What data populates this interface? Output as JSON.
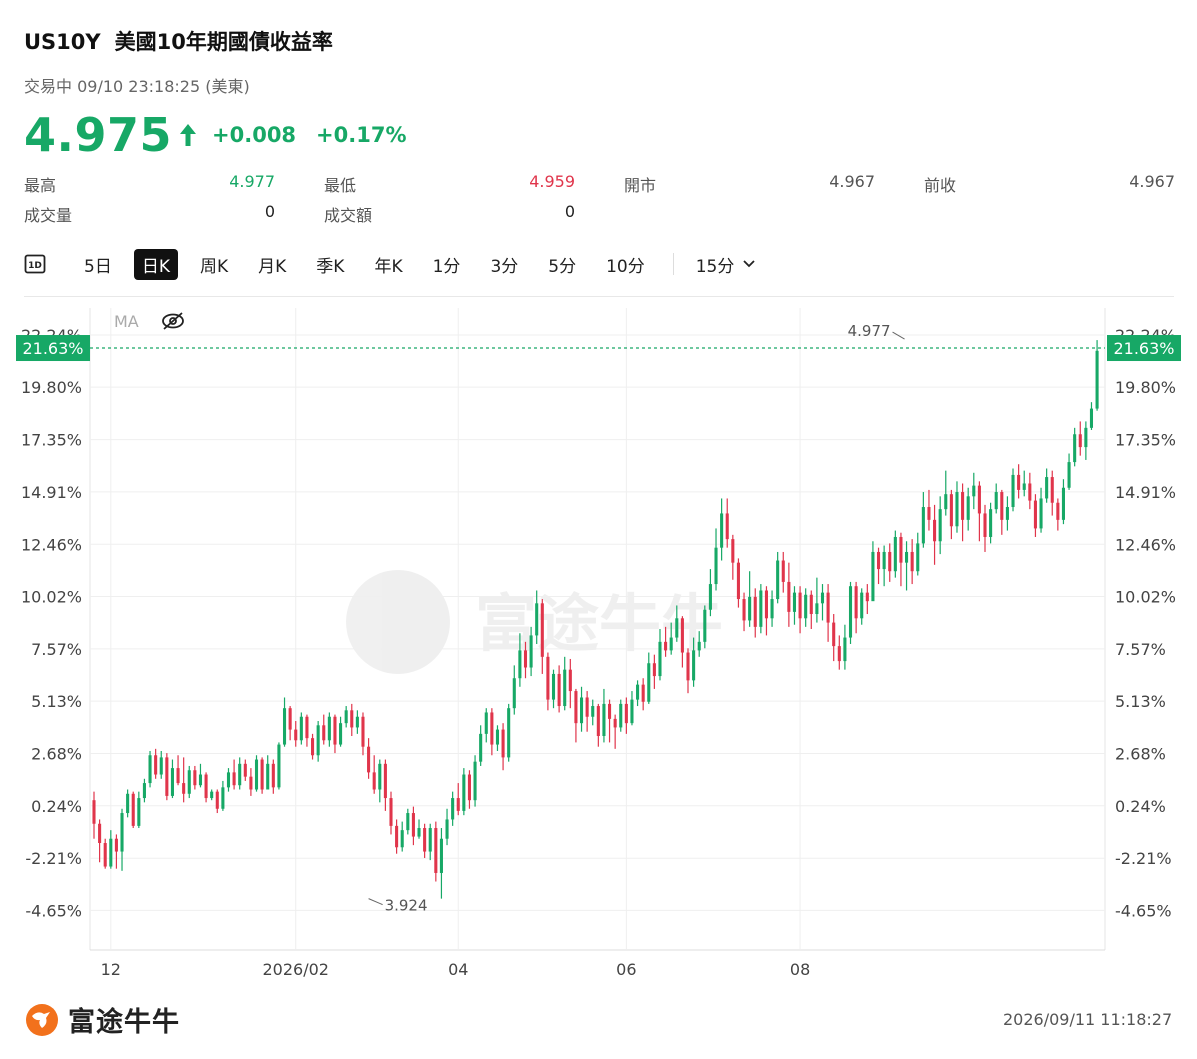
{
  "header": {
    "symbol": "US10Y",
    "name": "美國10年期國債收益率",
    "status": "交易中 09/10 23:18:25 (美東)",
    "price": "4.975",
    "change": "+0.008",
    "change_pct": "+0.17%"
  },
  "stats": [
    {
      "label": "最高",
      "value": "4.977",
      "color": "#17a866"
    },
    {
      "label": "最低",
      "value": "4.959",
      "color": "#e0354b"
    },
    {
      "label": "開市",
      "value": "4.967",
      "color": "#555555"
    },
    {
      "label": "前收",
      "value": "4.967",
      "color": "#555555"
    },
    {
      "label": "成交量",
      "value": "0",
      "color": "#222222"
    },
    {
      "label": "成交額",
      "value": "0",
      "color": "#222222"
    }
  ],
  "tabs": [
    "5日",
    "日K",
    "周K",
    "月K",
    "季K",
    "年K",
    "1分",
    "3分",
    "5分",
    "10分",
    "15分"
  ],
  "active_tab": "日K",
  "tab_icon_label": "1D",
  "indicator": {
    "label": "MA"
  },
  "footer": {
    "brand": "富途牛牛",
    "timestamp": "2026/09/11 11:18:27"
  },
  "colors": {
    "up": "#17a866",
    "down": "#e0354b",
    "grid": "#efefef",
    "axis_text": "#444444"
  },
  "chart_data": {
    "type": "candlestick",
    "y_unit": "percent change",
    "yticks": [
      22.24,
      19.8,
      17.35,
      14.91,
      12.46,
      10.02,
      7.57,
      5.13,
      2.68,
      0.24,
      -2.21,
      -4.65
    ],
    "ytick_labels": [
      "22.24%",
      "19.80%",
      "17.35%",
      "14.91%",
      "12.46%",
      "10.02%",
      "7.57%",
      "5.13%",
      "2.68%",
      "0.24%",
      "-2.21%",
      "-4.65%"
    ],
    "ylim": [
      -6.5,
      23.5
    ],
    "xticks": [
      {
        "label": "12",
        "index": 3
      },
      {
        "label": "2026/02",
        "index": 36
      },
      {
        "label": "04",
        "index": 65
      },
      {
        "label": "06",
        "index": 95
      },
      {
        "label": "08",
        "index": 126
      }
    ],
    "current_value": 21.63,
    "current_label": "21.63%",
    "annotations": [
      {
        "text": "4.977",
        "index": 145,
        "y": 22.0,
        "kind": "high"
      },
      {
        "text": "3.924",
        "index": 49,
        "y": -4.1,
        "kind": "low"
      }
    ],
    "candles": [
      [
        0.5,
        -0.6,
        0.9,
        -1.3
      ],
      [
        -0.6,
        -1.5,
        -0.4,
        -2.4
      ],
      [
        -1.5,
        -2.6,
        -1.3,
        -2.7
      ],
      [
        -2.6,
        -1.3,
        -0.9,
        -2.7
      ],
      [
        -1.3,
        -1.9,
        -1.1,
        -2.7
      ],
      [
        -1.9,
        -0.1,
        0.1,
        -2.8
      ],
      [
        -0.1,
        0.8,
        1.0,
        -0.3
      ],
      [
        0.8,
        -0.7,
        0.9,
        -0.8
      ],
      [
        -0.7,
        0.6,
        0.9,
        -0.8
      ],
      [
        0.6,
        1.3,
        1.5,
        0.4
      ],
      [
        1.3,
        2.6,
        2.8,
        1.1
      ],
      [
        2.6,
        1.7,
        2.9,
        1.5
      ],
      [
        1.7,
        2.5,
        2.8,
        1.5
      ],
      [
        2.5,
        0.7,
        2.7,
        0.5
      ],
      [
        0.7,
        2.0,
        2.4,
        0.6
      ],
      [
        2.0,
        1.3,
        2.6,
        1.2
      ],
      [
        1.3,
        0.8,
        2.5,
        0.4
      ],
      [
        0.8,
        1.9,
        2.1,
        0.6
      ],
      [
        1.9,
        1.2,
        2.1,
        1.0
      ],
      [
        1.2,
        1.7,
        2.2,
        1.1
      ],
      [
        1.7,
        0.6,
        1.8,
        0.4
      ],
      [
        0.6,
        0.9,
        1.0,
        0.5
      ],
      [
        0.9,
        0.1,
        1.0,
        -0.1
      ],
      [
        0.1,
        1.1,
        1.4,
        0.0
      ],
      [
        1.1,
        1.8,
        2.0,
        0.9
      ],
      [
        1.8,
        1.2,
        2.4,
        1.0
      ],
      [
        1.2,
        2.2,
        2.5,
        1.0
      ],
      [
        2.2,
        1.6,
        2.4,
        1.4
      ],
      [
        1.6,
        1.0,
        2.0,
        0.7
      ],
      [
        1.0,
        2.4,
        2.6,
        0.9
      ],
      [
        2.4,
        1.0,
        2.5,
        0.8
      ],
      [
        1.0,
        2.2,
        2.6,
        1.0
      ],
      [
        2.2,
        1.1,
        2.4,
        0.8
      ],
      [
        1.1,
        3.1,
        3.2,
        1.0
      ],
      [
        3.1,
        4.8,
        5.3,
        3.0
      ],
      [
        4.8,
        3.8,
        4.9,
        3.3
      ],
      [
        3.8,
        3.3,
        4.2,
        3.0
      ],
      [
        3.3,
        4.4,
        4.6,
        3.1
      ],
      [
        4.4,
        3.4,
        4.5,
        3.0
      ],
      [
        3.4,
        2.6,
        3.6,
        2.4
      ],
      [
        2.6,
        4.0,
        4.2,
        2.3
      ],
      [
        4.0,
        3.3,
        4.5,
        3.1
      ],
      [
        3.3,
        4.4,
        4.6,
        3.0
      ],
      [
        4.4,
        3.1,
        4.5,
        2.7
      ],
      [
        3.1,
        4.1,
        4.4,
        3.0
      ],
      [
        4.1,
        4.7,
        4.9,
        3.9
      ],
      [
        4.7,
        3.9,
        5.0,
        3.5
      ],
      [
        3.9,
        4.4,
        4.7,
        3.6
      ],
      [
        4.4,
        3.0,
        4.6,
        2.6
      ],
      [
        3.0,
        1.8,
        3.4,
        1.5
      ],
      [
        1.8,
        1.0,
        2.6,
        0.8
      ],
      [
        1.0,
        2.2,
        2.4,
        0.4
      ],
      [
        2.2,
        0.6,
        2.4,
        0.0
      ],
      [
        0.6,
        -0.7,
        0.9,
        -1.1
      ],
      [
        -0.7,
        -1.7,
        -0.4,
        -2.0
      ],
      [
        -1.7,
        -0.9,
        -0.5,
        -1.9
      ],
      [
        -0.9,
        -0.1,
        0.1,
        -1.1
      ],
      [
        -0.1,
        -1.2,
        0.2,
        -1.6
      ],
      [
        -1.2,
        -0.8,
        -0.4,
        -1.3
      ],
      [
        -0.8,
        -1.9,
        -0.6,
        -2.2
      ],
      [
        -1.9,
        -0.8,
        -0.6,
        -2.3
      ],
      [
        -0.8,
        -2.9,
        -0.5,
        -3.3
      ],
      [
        -2.9,
        -1.3,
        -0.8,
        -4.1
      ],
      [
        -1.3,
        -0.4,
        0.1,
        -1.6
      ],
      [
        -0.4,
        0.6,
        0.9,
        -0.7
      ],
      [
        0.6,
        0.0,
        1.3,
        -0.2
      ],
      [
        0.0,
        1.7,
        2.0,
        -0.2
      ],
      [
        1.7,
        0.5,
        1.9,
        0.1
      ],
      [
        0.5,
        2.3,
        2.6,
        0.2
      ],
      [
        2.3,
        3.6,
        4.0,
        2.1
      ],
      [
        3.6,
        4.6,
        4.8,
        3.2
      ],
      [
        4.6,
        3.1,
        4.8,
        2.6
      ],
      [
        3.1,
        3.8,
        4.0,
        2.8
      ],
      [
        3.8,
        2.5,
        4.1,
        1.9
      ],
      [
        2.5,
        4.8,
        5.0,
        2.3
      ],
      [
        4.8,
        6.2,
        6.8,
        4.5
      ],
      [
        6.2,
        7.5,
        8.3,
        5.8
      ],
      [
        7.5,
        6.7,
        7.9,
        6.2
      ],
      [
        6.7,
        8.2,
        8.6,
        6.3
      ],
      [
        8.2,
        9.7,
        10.3,
        7.8
      ],
      [
        9.7,
        7.2,
        9.9,
        6.4
      ],
      [
        7.2,
        5.2,
        7.4,
        4.7
      ],
      [
        5.2,
        6.4,
        6.6,
        4.8
      ],
      [
        6.4,
        4.9,
        6.8,
        4.6
      ],
      [
        4.9,
        6.6,
        7.2,
        4.7
      ],
      [
        6.6,
        5.6,
        7.1,
        4.8
      ],
      [
        5.6,
        4.1,
        5.7,
        3.2
      ],
      [
        4.1,
        5.3,
        5.8,
        3.7
      ],
      [
        5.3,
        4.4,
        5.6,
        3.7
      ],
      [
        4.4,
        4.9,
        5.2,
        4.0
      ],
      [
        4.9,
        3.5,
        5.0,
        3.0
      ],
      [
        3.5,
        5.0,
        5.7,
        3.2
      ],
      [
        5.0,
        4.3,
        5.2,
        3.2
      ],
      [
        4.3,
        3.9,
        4.5,
        2.9
      ],
      [
        3.9,
        5.0,
        5.2,
        3.7
      ],
      [
        5.0,
        4.1,
        5.3,
        3.6
      ],
      [
        4.1,
        5.2,
        5.6,
        4.0
      ],
      [
        5.2,
        5.9,
        6.1,
        4.9
      ],
      [
        5.9,
        5.1,
        6.2,
        4.7
      ],
      [
        5.1,
        6.9,
        7.4,
        5.0
      ],
      [
        6.9,
        6.3,
        7.3,
        5.7
      ],
      [
        6.3,
        7.9,
        8.5,
        6.1
      ],
      [
        7.9,
        7.5,
        8.6,
        7.2
      ],
      [
        7.5,
        8.1,
        8.8,
        7.3
      ],
      [
        8.1,
        9.0,
        9.6,
        7.9
      ],
      [
        9.0,
        7.4,
        9.1,
        6.7
      ],
      [
        7.4,
        6.1,
        7.6,
        5.5
      ],
      [
        6.1,
        7.5,
        8.1,
        5.8
      ],
      [
        7.5,
        7.9,
        8.4,
        7.2
      ],
      [
        7.9,
        9.4,
        9.6,
        7.6
      ],
      [
        9.4,
        10.6,
        11.3,
        9.1
      ],
      [
        10.6,
        12.3,
        13.2,
        10.3
      ],
      [
        12.3,
        13.9,
        14.6,
        11.7
      ],
      [
        13.9,
        12.7,
        14.6,
        12.3
      ],
      [
        12.7,
        11.6,
        12.9,
        10.8
      ],
      [
        11.6,
        9.9,
        11.8,
        9.5
      ],
      [
        9.9,
        8.9,
        10.2,
        8.4
      ],
      [
        8.9,
        10.0,
        11.2,
        8.6
      ],
      [
        10.0,
        8.6,
        10.4,
        8.1
      ],
      [
        8.6,
        10.3,
        10.6,
        8.3
      ],
      [
        10.3,
        9.0,
        10.5,
        8.2
      ],
      [
        9.0,
        9.9,
        10.3,
        8.6
      ],
      [
        9.9,
        11.7,
        12.1,
        9.7
      ],
      [
        11.7,
        10.7,
        12.1,
        10.2
      ],
      [
        10.7,
        9.3,
        11.6,
        8.6
      ],
      [
        9.3,
        10.2,
        10.5,
        8.7
      ],
      [
        10.2,
        9.0,
        10.5,
        8.3
      ],
      [
        9.0,
        10.1,
        10.4,
        8.6
      ],
      [
        10.1,
        9.2,
        10.3,
        8.5
      ],
      [
        9.2,
        9.7,
        10.9,
        8.8
      ],
      [
        9.7,
        10.2,
        10.6,
        8.9
      ],
      [
        10.2,
        8.8,
        10.6,
        7.9
      ],
      [
        8.8,
        7.7,
        9.2,
        7.0
      ],
      [
        7.7,
        7.0,
        8.2,
        6.6
      ],
      [
        7.0,
        8.1,
        8.7,
        6.6
      ],
      [
        8.1,
        10.5,
        10.7,
        7.8
      ],
      [
        10.5,
        9.0,
        10.7,
        8.3
      ],
      [
        9.0,
        10.2,
        10.4,
        8.7
      ],
      [
        10.2,
        9.8,
        10.6,
        9.2
      ],
      [
        9.8,
        12.1,
        12.6,
        9.9
      ],
      [
        12.1,
        11.3,
        12.3,
        10.6
      ],
      [
        11.3,
        12.1,
        12.4,
        10.5
      ],
      [
        12.1,
        11.2,
        12.5,
        10.7
      ],
      [
        11.2,
        12.8,
        13.1,
        10.9
      ],
      [
        12.8,
        11.6,
        13.0,
        10.5
      ],
      [
        11.6,
        12.1,
        12.6,
        10.3
      ],
      [
        12.1,
        11.2,
        12.7,
        10.6
      ],
      [
        11.2,
        12.5,
        13.0,
        11.0
      ],
      [
        12.5,
        14.2,
        14.9,
        12.3
      ],
      [
        14.2,
        13.6,
        15.0,
        13.1
      ],
      [
        13.6,
        12.6,
        14.3,
        11.5
      ],
      [
        12.6,
        14.1,
        14.7,
        12.0
      ],
      [
        14.1,
        14.8,
        15.9,
        13.8
      ],
      [
        14.8,
        13.3,
        15.0,
        12.7
      ],
      [
        13.3,
        14.9,
        15.4,
        13.0
      ],
      [
        14.9,
        13.6,
        15.3,
        12.6
      ],
      [
        13.6,
        14.7,
        15.1,
        13.1
      ],
      [
        14.7,
        15.2,
        15.8,
        14.1
      ],
      [
        15.2,
        13.9,
        15.4,
        12.6
      ],
      [
        13.9,
        12.8,
        14.3,
        12.1
      ],
      [
        12.8,
        14.1,
        14.4,
        12.5
      ],
      [
        14.1,
        14.9,
        15.3,
        13.9
      ],
      [
        14.9,
        13.6,
        15.0,
        12.9
      ],
      [
        13.6,
        14.2,
        14.7,
        13.1
      ],
      [
        14.2,
        15.7,
        16.0,
        14.0
      ],
      [
        15.7,
        15.0,
        16.2,
        14.6
      ],
      [
        15.0,
        15.3,
        15.9,
        14.7
      ],
      [
        15.3,
        14.5,
        15.8,
        14.1
      ],
      [
        14.5,
        13.2,
        14.8,
        12.8
      ],
      [
        13.2,
        14.6,
        15.1,
        13.0
      ],
      [
        14.6,
        15.6,
        16.0,
        14.4
      ],
      [
        15.6,
        14.4,
        15.9,
        13.8
      ],
      [
        14.4,
        13.6,
        14.6,
        13.1
      ],
      [
        13.6,
        15.1,
        15.5,
        13.4
      ],
      [
        15.1,
        16.3,
        16.7,
        15.0
      ],
      [
        16.3,
        17.6,
        17.9,
        16.1
      ],
      [
        17.6,
        17.0,
        18.2,
        16.6
      ],
      [
        17.0,
        17.9,
        18.2,
        16.4
      ],
      [
        17.9,
        18.8,
        19.1,
        17.8
      ],
      [
        18.8,
        21.5,
        22.0,
        18.7
      ]
    ]
  }
}
